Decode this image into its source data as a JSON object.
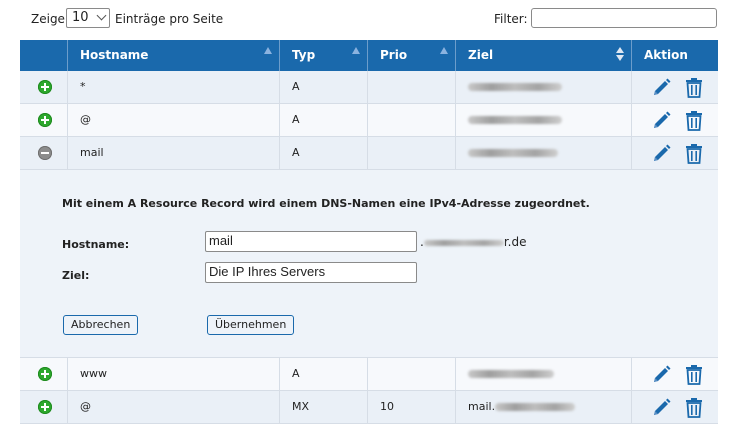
{
  "top": {
    "show_label": "Zeige",
    "per_page_value": "10",
    "per_page_after": "Einträge pro Seite",
    "filter_label": "Filter:",
    "filter_value": ""
  },
  "table": {
    "headers": {
      "hostname": "Hostname",
      "type": "Typ",
      "prio": "Prio",
      "target": "Ziel",
      "action": "Aktion"
    },
    "rows": [
      {
        "expand": "plus",
        "hostname": "*",
        "type": "A",
        "prio": "",
        "target_prefix": ""
      },
      {
        "expand": "plus",
        "hostname": "@",
        "type": "A",
        "prio": "",
        "target_prefix": ""
      },
      {
        "expand": "minus",
        "hostname": "mail",
        "type": "A",
        "prio": "",
        "target_prefix": ""
      },
      {
        "expand": "plus",
        "hostname": "www",
        "type": "A",
        "prio": "",
        "target_prefix": ""
      },
      {
        "expand": "plus",
        "hostname": "@",
        "type": "MX",
        "prio": "10",
        "target_prefix": "mail."
      }
    ]
  },
  "detail": {
    "description": "Mit einem A Resource Record wird einem DNS-Namen eine IPv4-Adresse zugeordnet.",
    "hostname_label": "Hostname:",
    "hostname_value": "mail",
    "domain_suffix_start": ".",
    "domain_suffix_end": "r.de",
    "target_label": "Ziel:",
    "target_value": "Die IP Ihres Servers",
    "cancel_label": "Abbrechen",
    "apply_label": "Übernehmen"
  },
  "colors": {
    "header_bg": "#1a69ac",
    "row_alt": "#eaf0f7",
    "plus": "#2da82d",
    "icon": "#1a69ac"
  },
  "icons": [
    "plus-circle-icon",
    "minus-circle-icon",
    "pencil-icon",
    "trash-icon",
    "sort-arrow-icon"
  ]
}
